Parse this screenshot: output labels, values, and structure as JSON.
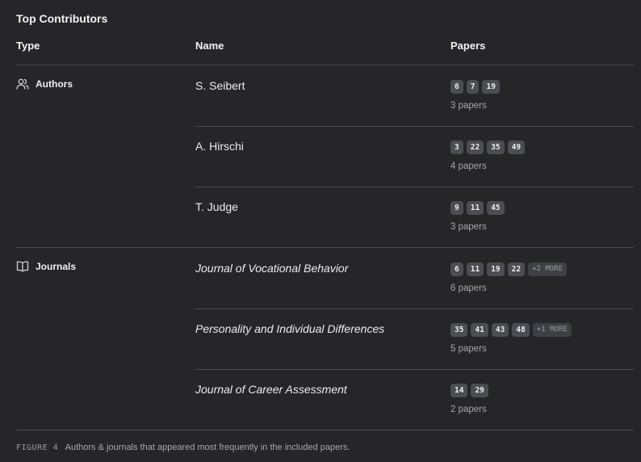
{
  "title": "Top Contributors",
  "columns": {
    "type": "Type",
    "name": "Name",
    "papers": "Papers"
  },
  "groups": [
    {
      "label": "Authors",
      "icon": "users-icon",
      "rows": [
        {
          "name": "S. Seibert",
          "badges": [
            "6",
            "7",
            "19"
          ],
          "more": "",
          "count": "3 papers"
        },
        {
          "name": "A. Hirschi",
          "badges": [
            "3",
            "22",
            "35",
            "49"
          ],
          "more": "",
          "count": "4 papers"
        },
        {
          "name": "T. Judge",
          "badges": [
            "9",
            "11",
            "45"
          ],
          "more": "",
          "count": "3 papers"
        }
      ]
    },
    {
      "label": "Journals",
      "icon": "book-icon",
      "rows": [
        {
          "name": "Journal of Vocational Behavior",
          "badges": [
            "6",
            "11",
            "19",
            "22"
          ],
          "more": "+2 MORE",
          "count": "6 papers"
        },
        {
          "name": "Personality and Individual Differences",
          "badges": [
            "35",
            "41",
            "43",
            "48"
          ],
          "more": "+1 MORE",
          "count": "5 papers"
        },
        {
          "name": "Journal of Career Assessment",
          "badges": [
            "14",
            "29"
          ],
          "more": "",
          "count": "2 papers"
        }
      ]
    }
  ],
  "caption": {
    "figure": "FIGURE 4",
    "text": "Authors & journals that appeared most frequently in the included papers."
  },
  "colors": {
    "background": "#262628",
    "badge": "#4c4d52",
    "divider": "#4a4a4d"
  }
}
